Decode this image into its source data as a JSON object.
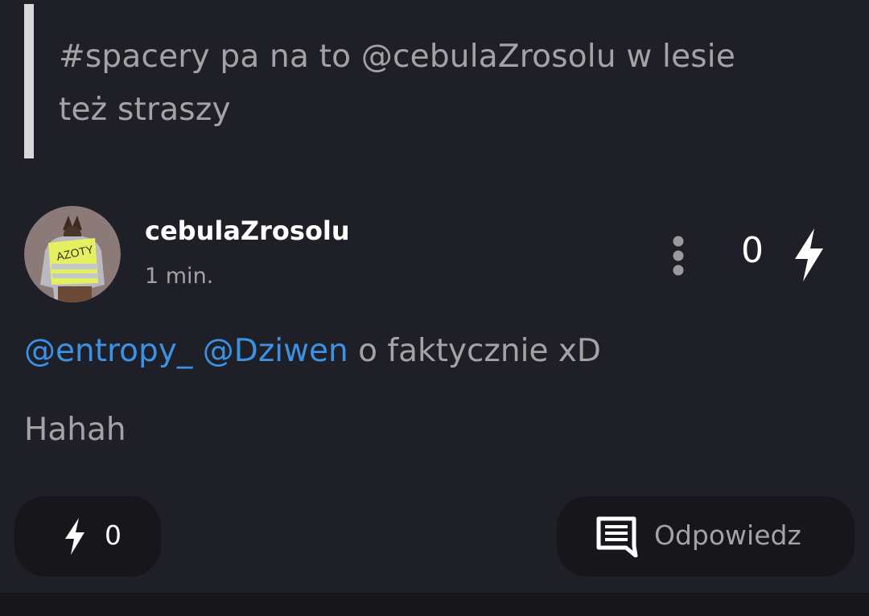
{
  "parent_quote": {
    "line1": "#spacery pa na to @cebulaZrosolu w lesie",
    "line2": "też straszy"
  },
  "post": {
    "author": "cebulaZrosolu",
    "time": "1 min.",
    "score": "0",
    "avatar_caption": "AZOTY",
    "mentions": [
      "@entropy_",
      "@Dziwen"
    ],
    "text_after_mentions": " o faktycznie xD",
    "second_line": "Hahah"
  },
  "actions": {
    "like_count": "0",
    "reply_label": "Odpowiedz"
  },
  "icons": {
    "more": "more-vertical-icon",
    "vote": "lightning-bolt-icon",
    "reply": "comment-icon"
  },
  "colors": {
    "background": "#1f1f28",
    "mention": "#3b91e3",
    "muted_text": "#a3a3a6",
    "pill": "#17171b"
  }
}
